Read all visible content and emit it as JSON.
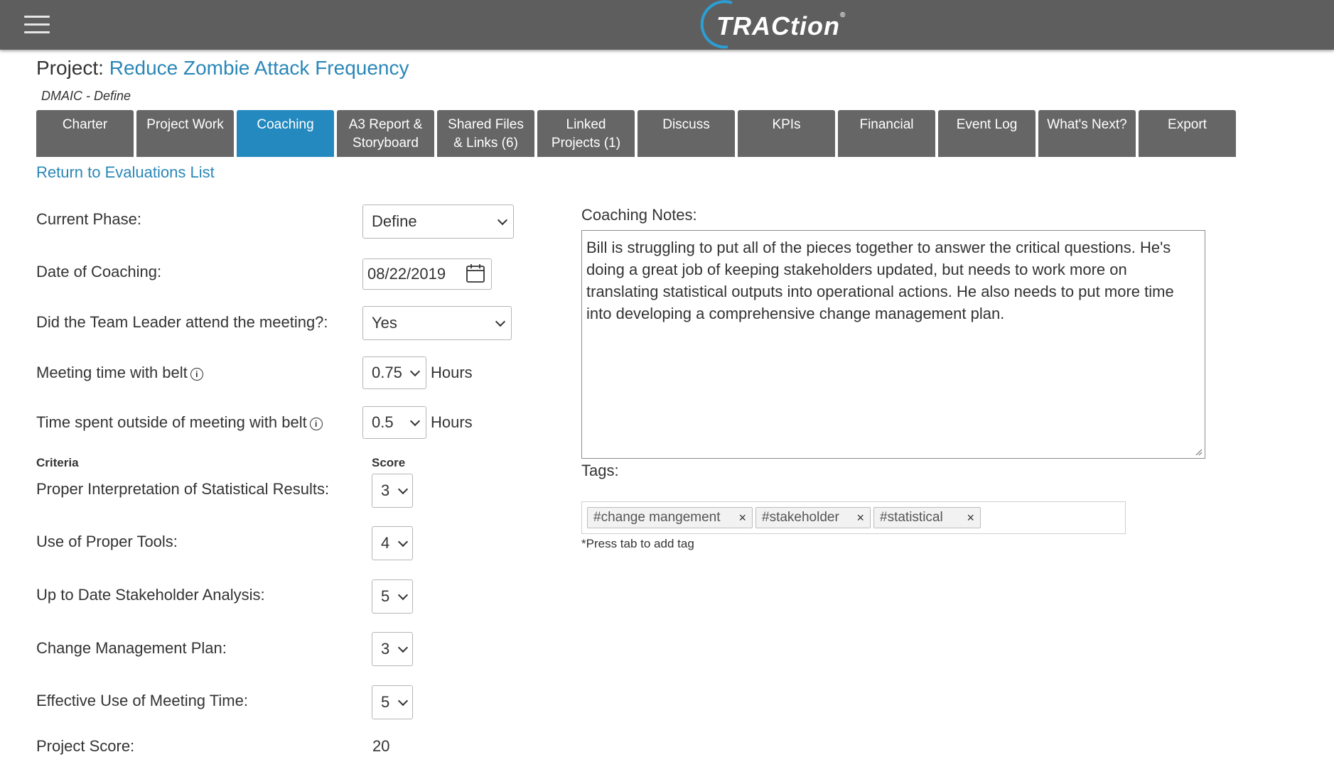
{
  "header": {
    "logo_text": "TRACtion",
    "logo_reg": "®"
  },
  "project": {
    "prefix": "Project:",
    "name": "Reduce Zombie Attack Frequency",
    "phase_sub": "DMAIC - Define"
  },
  "tabs": [
    {
      "line1": "Charter",
      "line2": ""
    },
    {
      "line1": "Project Work",
      "line2": ""
    },
    {
      "line1": "Coaching",
      "line2": ""
    },
    {
      "line1": "A3 Report &",
      "line2": "Storyboard"
    },
    {
      "line1": "Shared Files",
      "line2": "& Links (6)"
    },
    {
      "line1": "Linked",
      "line2": "Projects (1)"
    },
    {
      "line1": "Discuss",
      "line2": ""
    },
    {
      "line1": "KPIs",
      "line2": ""
    },
    {
      "line1": "Financial",
      "line2": ""
    },
    {
      "line1": "Event Log",
      "line2": ""
    },
    {
      "line1": "What's Next?",
      "line2": ""
    },
    {
      "line1": "Export",
      "line2": ""
    }
  ],
  "return_link": "Return to Evaluations List",
  "form": {
    "current_phase_label": "Current Phase:",
    "current_phase_value": "Define",
    "date_label": "Date of Coaching:",
    "date_value": "08/22/2019",
    "leader_label": "Did the Team Leader attend the meeting?:",
    "leader_value": "Yes",
    "meeting_time_label": "Meeting time with belt",
    "meeting_time_value": "0.75",
    "outside_time_label": "Time spent outside of meeting with belt",
    "outside_time_value": "0.5",
    "hours_label": "Hours",
    "info_symbol": "i"
  },
  "criteria": {
    "criteria_header": "Criteria",
    "score_header": "Score",
    "items": [
      {
        "label": "Proper Interpretation of Statistical Results:",
        "score": "3"
      },
      {
        "label": "Use of Proper Tools:",
        "score": "4"
      },
      {
        "label": "Up to Date Stakeholder Analysis:",
        "score": "5"
      },
      {
        "label": "Change Management Plan:",
        "score": "3"
      },
      {
        "label": "Effective Use of Meeting Time:",
        "score": "5"
      }
    ],
    "project_score_label": "Project Score:",
    "project_score_value": "20"
  },
  "notes": {
    "label": "Coaching Notes:",
    "text": "Bill is struggling to put all of the pieces together to answer the critical questions. He's doing a great job of keeping stakeholders updated, but needs to work more on translating statistical outputs into operational actions.  He also needs to put more time into developing a comprehensive change management plan."
  },
  "tags": {
    "label": "Tags:",
    "items": [
      "#change mangement",
      "#stakeholder",
      "#statistical"
    ],
    "remove_symbol": "×",
    "hint": "*Press tab to add tag"
  },
  "colors": {
    "topbar": "#5e5e5e",
    "tab": "#666666",
    "tab_active": "#2489bf",
    "link": "#2a87b8"
  }
}
